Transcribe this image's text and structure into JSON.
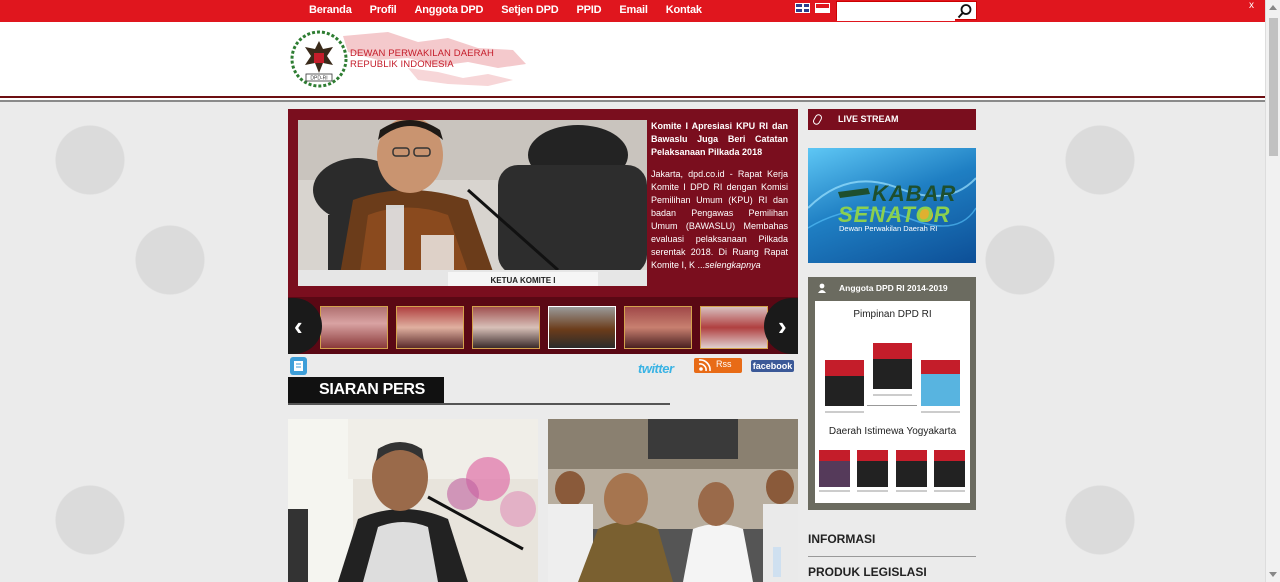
{
  "nav": {
    "items": [
      "Beranda",
      "Profil",
      "Anggota DPD",
      "Setjen DPD",
      "PPID",
      "Email",
      "Kontak"
    ]
  },
  "search": {
    "placeholder": "",
    "value": ""
  },
  "window": {
    "close_label": "x"
  },
  "header": {
    "logo_line1": "DEWAN PERWAKILAN DAERAH",
    "logo_line2": "REPUBLIK INDONESIA",
    "emblem_text": "DPD-RI"
  },
  "slider": {
    "title": "Komite I Apresiasi KPU RI dan Bawaslu Juga Beri Catatan Pelaksanaan Pilkada 2018",
    "body": "Jakarta, dpd.co.id - Rapat Kerja Komite I DPD RI dengan Komisi Pemilihan Umum (KPU) RI dan badan Pengawas Pemilihan Umum (BAWASLU) Membahas evaluasi pelaksanaan Pilkada serentak 2018. Di Ruang Rapat Komite I, K ...",
    "more": "selengkapnya",
    "photo_caption": "KETUA KOMITE I",
    "prev_label": "‹",
    "next_label": "›"
  },
  "social": {
    "twitter": "twitter",
    "rss": "Rss",
    "facebook": "facebook"
  },
  "siaran": {
    "heading": "SIARAN PERS"
  },
  "sidebar": {
    "live_stream": "LIVE STREAM",
    "kabar_title1": "KABAR",
    "kabar_title2": "SENATOR",
    "kabar_sub": "Dewan Perwakilan Daerah RI",
    "anggota_heading": "Anggota DPD RI 2014-2019",
    "pimpinan_title": "Pimpinan DPD RI",
    "region_title": "Daerah Istimewa Yogyakarta",
    "links": [
      "INFORMASI",
      "PRODUK LEGISLASI"
    ]
  },
  "colors": {
    "topbar": "#e0161e",
    "maroon": "#7a0e1e",
    "dark": "#111111"
  }
}
